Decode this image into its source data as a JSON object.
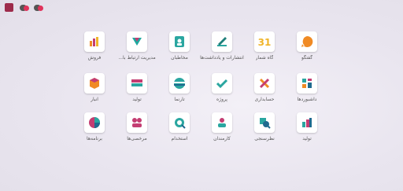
{
  "topbar": {
    "notifications_count": "",
    "messages_count": ""
  },
  "apps": [
    {
      "id": "discuss",
      "label": "گفتگو",
      "icon": "discuss-icon"
    },
    {
      "id": "calendar",
      "label": "گاه شمار",
      "icon": "calendar-icon",
      "icon_text": "31"
    },
    {
      "id": "notes",
      "label": "انتشارات و یادداشت‌ها",
      "icon": "notes-icon"
    },
    {
      "id": "contacts",
      "label": "مخاطبان",
      "icon": "contacts-icon"
    },
    {
      "id": "crm",
      "label": "مدیریت ارتباط با...",
      "icon": "crm-icon"
    },
    {
      "id": "sales",
      "label": "فروش",
      "icon": "sales-icon"
    },
    {
      "id": "dashboards",
      "label": "داشبوردها",
      "icon": "dashboards-icon"
    },
    {
      "id": "accounting",
      "label": "حسابداری",
      "icon": "accounting-icon"
    },
    {
      "id": "project",
      "label": "پروژه",
      "icon": "project-icon"
    },
    {
      "id": "website",
      "label": "تارنما",
      "icon": "website-icon"
    },
    {
      "id": "invoicing",
      "label": "تولید",
      "icon": "invoicing-icon"
    },
    {
      "id": "inventory",
      "label": "انبار",
      "icon": "inventory-icon"
    },
    {
      "id": "manufacturing",
      "label": "تولید",
      "icon": "manufacturing-icon"
    },
    {
      "id": "survey",
      "label": "نظرسنجی",
      "icon": "survey-icon"
    },
    {
      "id": "employees",
      "label": "کارمندان",
      "icon": "employees-icon"
    },
    {
      "id": "recruitment",
      "label": "استخدام",
      "icon": "recruitment-icon"
    },
    {
      "id": "leaves",
      "label": "مرخصی‌ها",
      "icon": "leaves-icon"
    },
    {
      "id": "apps",
      "label": "برنامه‌ها",
      "icon": "apps-icon"
    }
  ]
}
